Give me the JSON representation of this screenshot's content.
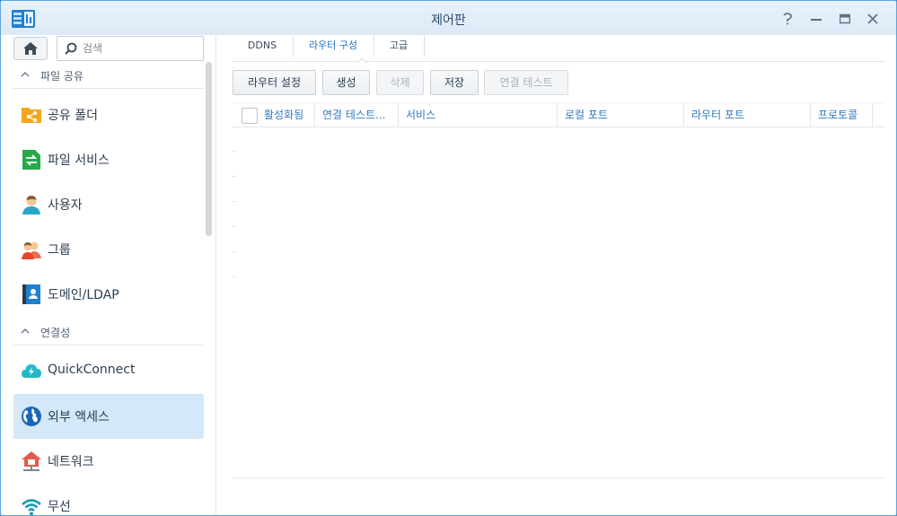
{
  "window": {
    "title": "제어판",
    "controls": {
      "help": "help-icon",
      "minimize": "minimize-icon",
      "maximize": "maximize-icon",
      "close": "close-icon"
    }
  },
  "sidebar": {
    "search": {
      "placeholder": "검색",
      "value": ""
    },
    "sections": [
      {
        "label": "파일 공유",
        "items": [
          {
            "label": "공유 폴더",
            "icon": "shared-folder-icon"
          },
          {
            "label": "파일 서비스",
            "icon": "file-services-icon"
          },
          {
            "label": "사용자",
            "icon": "user-icon"
          },
          {
            "label": "그룹",
            "icon": "group-icon"
          },
          {
            "label": "도메인/LDAP",
            "icon": "domain-ldap-icon"
          }
        ]
      },
      {
        "label": "연결성",
        "items": [
          {
            "label": "QuickConnect",
            "icon": "quickconnect-icon"
          },
          {
            "label": "외부 액세스",
            "icon": "external-access-icon",
            "active": true
          },
          {
            "label": "네트워크",
            "icon": "network-icon"
          },
          {
            "label": "무선",
            "icon": "wireless-icon"
          }
        ]
      }
    ]
  },
  "main": {
    "tabs": [
      {
        "label": "DDNS"
      },
      {
        "label": "라우터 구성",
        "active": true
      },
      {
        "label": "고급"
      }
    ],
    "toolbar": {
      "router_setup": "라우터 설정",
      "create": "생성",
      "delete": "삭제",
      "save": "저장",
      "test_connection": "연결 테스트"
    },
    "grid": {
      "columns": [
        "활성화됨",
        "연결 테스트...",
        "서비스",
        "로컬 포트",
        "라우터 포트",
        "프로토콜"
      ]
    }
  },
  "colors": {
    "accent": "#1f6fbf",
    "active_nav": "#d4e8f9",
    "header_text": "#2f7ac0",
    "title_bar": "#e4eef9"
  }
}
